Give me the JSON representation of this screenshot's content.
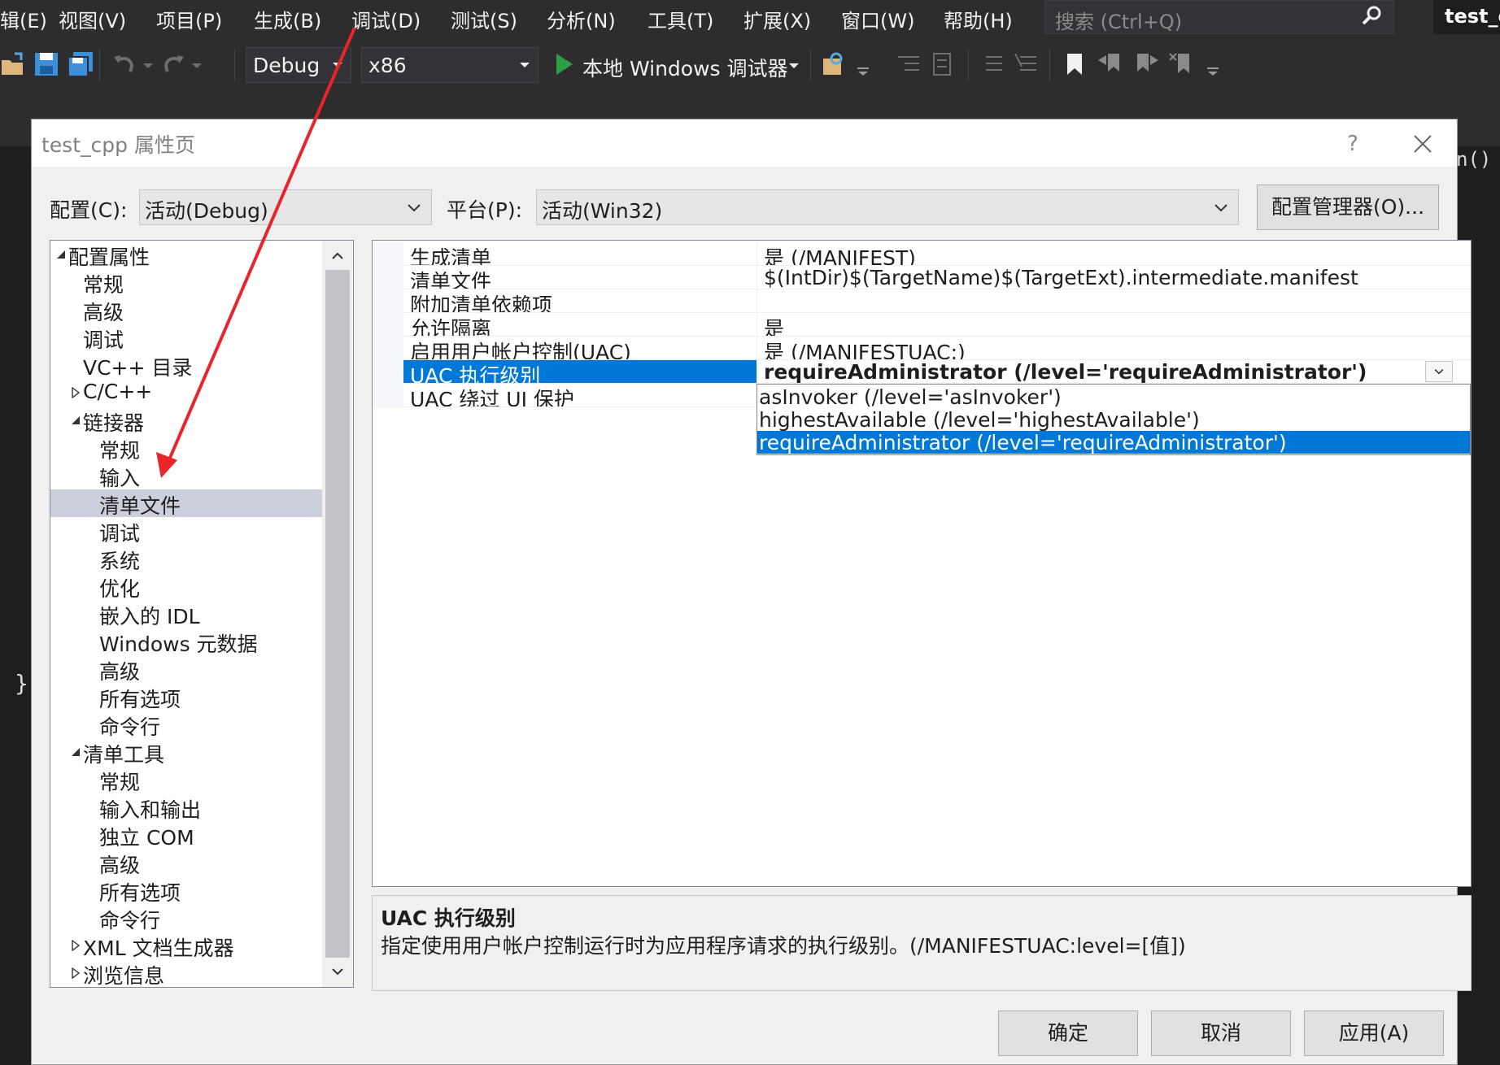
{
  "menubar": {
    "items": [
      "辑(E)",
      "视图(V)",
      "项目(P)",
      "生成(B)",
      "调试(D)",
      "测试(S)",
      "分析(N)",
      "工具(T)",
      "扩展(X)",
      "窗口(W)",
      "帮助(H)"
    ],
    "search_placeholder": "搜索 (Ctrl+Q)",
    "project_name": "test_c"
  },
  "toolbar": {
    "configuration": "Debug",
    "platform": "x86",
    "run_label": "本地 Windows 调试器"
  },
  "background": {
    "code_fragment": "n()",
    "brace": "}"
  },
  "dialog": {
    "title": "test_cpp 属性页",
    "help": "?",
    "config_label": "配置(C):",
    "config_value": "活动(Debug)",
    "platform_label": "平台(P):",
    "platform_value": "活动(Win32)",
    "config_manager": "配置管理器(O)...",
    "tree": [
      {
        "label": "配置属性",
        "level": 0,
        "expander": "expanded"
      },
      {
        "label": "常规",
        "level": 1,
        "expander": "none"
      },
      {
        "label": "高级",
        "level": 1,
        "expander": "none"
      },
      {
        "label": "调试",
        "level": 1,
        "expander": "none"
      },
      {
        "label": "VC++ 目录",
        "level": 1,
        "expander": "none"
      },
      {
        "label": "C/C++",
        "level": 1,
        "expander": "collapsed"
      },
      {
        "label": "链接器",
        "level": 1,
        "expander": "expanded"
      },
      {
        "label": "常规",
        "level": 2,
        "expander": "none"
      },
      {
        "label": "输入",
        "level": 2,
        "expander": "none"
      },
      {
        "label": "清单文件",
        "level": 2,
        "expander": "none",
        "selected": true
      },
      {
        "label": "调试",
        "level": 2,
        "expander": "none"
      },
      {
        "label": "系统",
        "level": 2,
        "expander": "none"
      },
      {
        "label": "优化",
        "level": 2,
        "expander": "none"
      },
      {
        "label": "嵌入的 IDL",
        "level": 2,
        "expander": "none"
      },
      {
        "label": "Windows 元数据",
        "level": 2,
        "expander": "none"
      },
      {
        "label": "高级",
        "level": 2,
        "expander": "none"
      },
      {
        "label": "所有选项",
        "level": 2,
        "expander": "none"
      },
      {
        "label": "命令行",
        "level": 2,
        "expander": "none"
      },
      {
        "label": "清单工具",
        "level": 1,
        "expander": "expanded"
      },
      {
        "label": "常规",
        "level": 2,
        "expander": "none"
      },
      {
        "label": "输入和输出",
        "level": 2,
        "expander": "none"
      },
      {
        "label": "独立 COM",
        "level": 2,
        "expander": "none"
      },
      {
        "label": "高级",
        "level": 2,
        "expander": "none"
      },
      {
        "label": "所有选项",
        "level": 2,
        "expander": "none"
      },
      {
        "label": "命令行",
        "level": 2,
        "expander": "none"
      },
      {
        "label": "XML 文档生成器",
        "level": 1,
        "expander": "collapsed"
      },
      {
        "label": "浏览信息",
        "level": 1,
        "expander": "collapsed"
      }
    ],
    "properties": [
      {
        "name": "生成清单",
        "value": "是 (/MANIFEST)"
      },
      {
        "name": "清单文件",
        "value": "$(IntDir)$(TargetName)$(TargetExt).intermediate.manifest"
      },
      {
        "name": "附加清单依赖项",
        "value": ""
      },
      {
        "name": "允许隔离",
        "value": "是"
      },
      {
        "name": "启用用户帐户控制(UAC)",
        "value": "是 (/MANIFESTUAC:)"
      },
      {
        "name": "UAC 执行级别",
        "value": "requireAdministrator (/level='requireAdministrator')",
        "selected": true
      },
      {
        "name": "UAC 绕过 UI 保护",
        "value": ""
      }
    ],
    "dropdown_options": [
      {
        "label": "asInvoker (/level='asInvoker')"
      },
      {
        "label": "highestAvailable (/level='highestAvailable')"
      },
      {
        "label": "requireAdministrator (/level='requireAdministrator')",
        "selected": true
      }
    ],
    "description": {
      "title": "UAC 执行级别",
      "text": "指定使用用户帐户控制运行时为应用程序请求的执行级别。(/MANIFESTUAC:level=[值])"
    },
    "buttons": {
      "ok": "确定",
      "cancel": "取消",
      "apply": "应用(A)"
    }
  },
  "colors": {
    "selection_blue": "#0078d7",
    "tree_selection": "#cccedb",
    "annotation_arrow": "#e8262a",
    "vs_dark": "#2d2d30"
  }
}
